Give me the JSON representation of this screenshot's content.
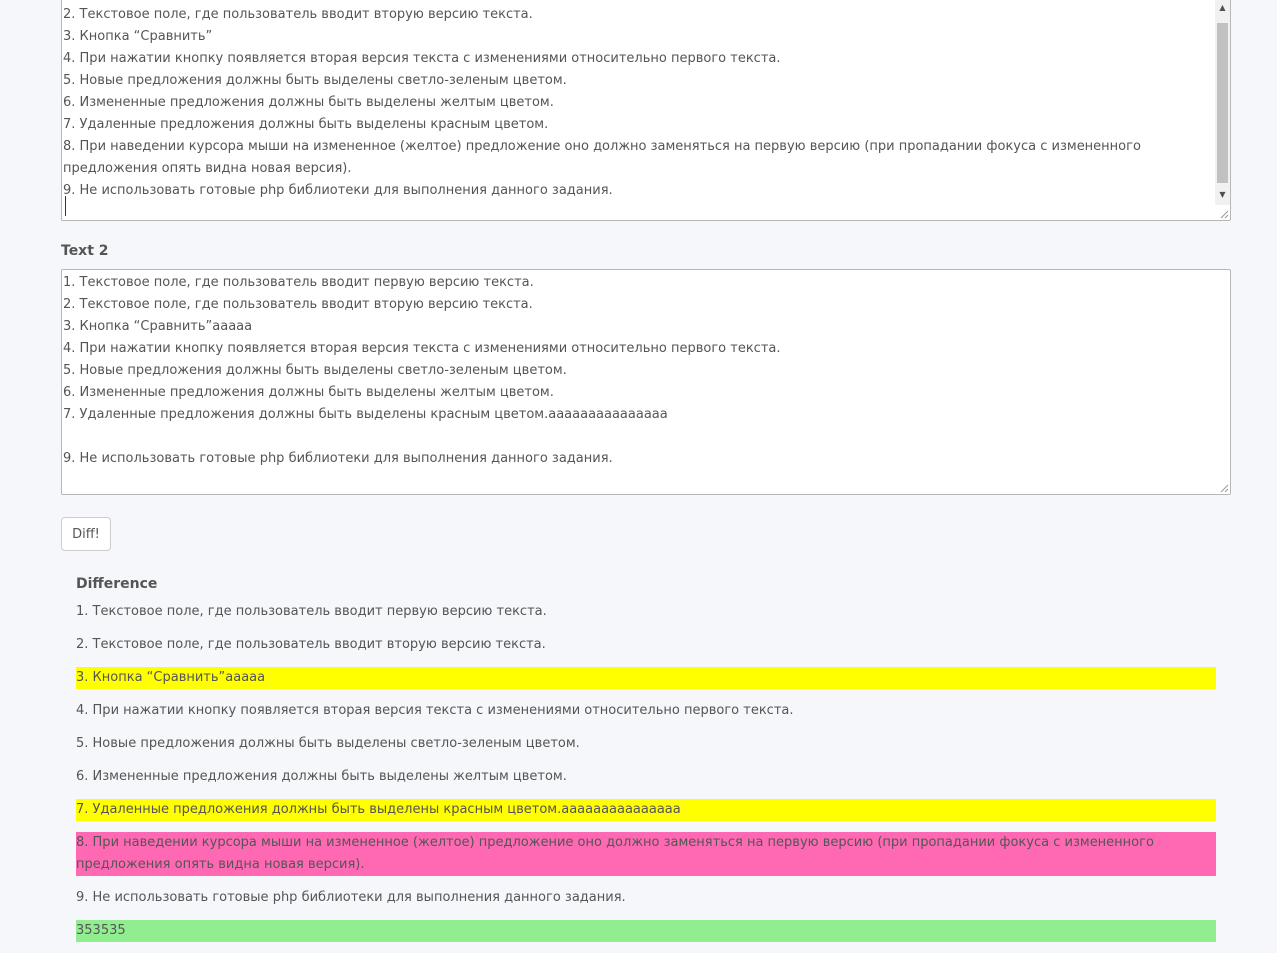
{
  "text1": {
    "lines": [
      "2. Текстовое поле, где пользователь вводит вторую версию текста.",
      "3. Кнопка “Сравнить”",
      "4. При нажатии кнопку появляется вторая версия текста с изменениями относительно первого текста.",
      "5. Новые предложения должны быть выделены светло-зеленым цветом.",
      "6. Измененные предложения должны быть выделены желтым цветом.",
      "7. Удаленные предложения должны быть выделены красным цветом.",
      "8. При наведении курсора мыши на измененное (желтое) предложение оно должно заменяться на первую версию (при пропадании фокуса с измененного предложения опять видна новая версия).",
      "9. Не использовать готовые php библиотеки для выполнения данного задания."
    ]
  },
  "text2": {
    "label": "Text 2",
    "lines": [
      "1. Текстовое поле, где пользователь вводит первую версию текста.",
      "2. Текстовое поле, где пользователь вводит вторую версию текста.",
      "3. Кнопка “Сравнить”aaaaa",
      "4. При нажатии кнопку появляется вторая версия текста с изменениями относительно первого текста.",
      "5. Новые предложения должны быть выделены светло-зеленым цветом.",
      "6. Измененные предложения должны быть выделены желтым цветом.",
      "7. Удаленные предложения должны быть выделены красным цветом.aaaaaaaaaaaaaaa",
      "",
      "9. Не использовать готовые php библиотеки для выполнения данного задания."
    ]
  },
  "diff_button": {
    "label": "Diff!"
  },
  "difference": {
    "title": "Difference",
    "colors": {
      "changed": "#ffff00",
      "removed": "#ff69b4",
      "added": "#90ee90"
    },
    "rows": [
      {
        "text": "1. Текстовое поле, где пользователь вводит первую версию текста.",
        "status": "unchanged"
      },
      {
        "text": "2. Текстовое поле, где пользователь вводит вторую версию текста.",
        "status": "unchanged"
      },
      {
        "text": "3. Кнопка “Сравнить”aaaaa",
        "status": "changed"
      },
      {
        "text": "4. При нажатии кнопку появляется вторая версия текста с изменениями относительно первого текста.",
        "status": "unchanged"
      },
      {
        "text": "5. Новые предложения должны быть выделены светло-зеленым цветом.",
        "status": "unchanged"
      },
      {
        "text": "6. Измененные предложения должны быть выделены желтым цветом.",
        "status": "unchanged"
      },
      {
        "text": "7. Удаленные предложения должны быть выделены красным цветом.aaaaaaaaaaaaaaa",
        "status": "changed"
      },
      {
        "text": "8. При наведении курсора мыши на измененное (желтое) предложение оно должно заменяться на первую версию (при пропадании фокуса с измененного предложения опять видна новая версия).",
        "status": "removed"
      },
      {
        "text": "9. Не использовать готовые php библиотеки для выполнения данного задания.",
        "status": "unchanged"
      },
      {
        "text": "353535",
        "status": "added"
      }
    ]
  }
}
